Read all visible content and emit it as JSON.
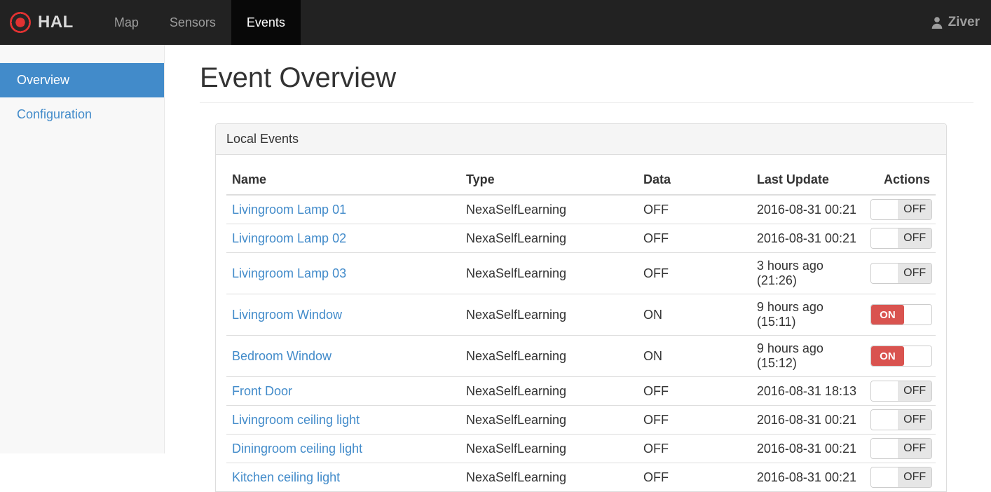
{
  "navbar": {
    "brand": "HAL",
    "items": [
      {
        "label": "Map",
        "active": false
      },
      {
        "label": "Sensors",
        "active": false
      },
      {
        "label": "Events",
        "active": true
      }
    ],
    "user": "Ziver"
  },
  "sidebar": {
    "items": [
      {
        "label": "Overview",
        "active": true
      },
      {
        "label": "Configuration",
        "active": false
      }
    ]
  },
  "main": {
    "title": "Event Overview",
    "panel": {
      "title": "Local Events",
      "table": {
        "columns": [
          "Name",
          "Type",
          "Data",
          "Last Update",
          "Actions"
        ],
        "rows": [
          {
            "name": "Livingroom Lamp 01",
            "type": "NexaSelfLearning",
            "data": "OFF",
            "last_update": "2016-08-31 00:21",
            "switch": "OFF"
          },
          {
            "name": "Livingroom Lamp 02",
            "type": "NexaSelfLearning",
            "data": "OFF",
            "last_update": "2016-08-31 00:21",
            "switch": "OFF"
          },
          {
            "name": "Livingroom Lamp 03",
            "type": "NexaSelfLearning",
            "data": "OFF",
            "last_update": "3 hours ago (21:26)",
            "switch": "OFF"
          },
          {
            "name": "Livingroom Window",
            "type": "NexaSelfLearning",
            "data": "ON",
            "last_update": "9 hours ago (15:11)",
            "switch": "ON"
          },
          {
            "name": "Bedroom Window",
            "type": "NexaSelfLearning",
            "data": "ON",
            "last_update": "9 hours ago (15:12)",
            "switch": "ON"
          },
          {
            "name": "Front Door",
            "type": "NexaSelfLearning",
            "data": "OFF",
            "last_update": "2016-08-31 18:13",
            "switch": "OFF"
          },
          {
            "name": "Livingroom ceiling light",
            "type": "NexaSelfLearning",
            "data": "OFF",
            "last_update": "2016-08-31 00:21",
            "switch": "OFF"
          },
          {
            "name": "Diningroom ceiling light",
            "type": "NexaSelfLearning",
            "data": "OFF",
            "last_update": "2016-08-31 00:21",
            "switch": "OFF"
          },
          {
            "name": "Kitchen ceiling light",
            "type": "NexaSelfLearning",
            "data": "OFF",
            "last_update": "2016-08-31 00:21",
            "switch": "OFF"
          }
        ]
      }
    }
  },
  "icons": {
    "logo": "target-icon",
    "user": "person-icon"
  },
  "colors": {
    "navbar_bg": "#222222",
    "navbar_active_bg": "#080808",
    "accent_blue": "#428bca",
    "switch_on_red": "#d9534f",
    "switch_off_gray": "#e6e6e6",
    "sidebar_bg": "#f8f8f8"
  }
}
